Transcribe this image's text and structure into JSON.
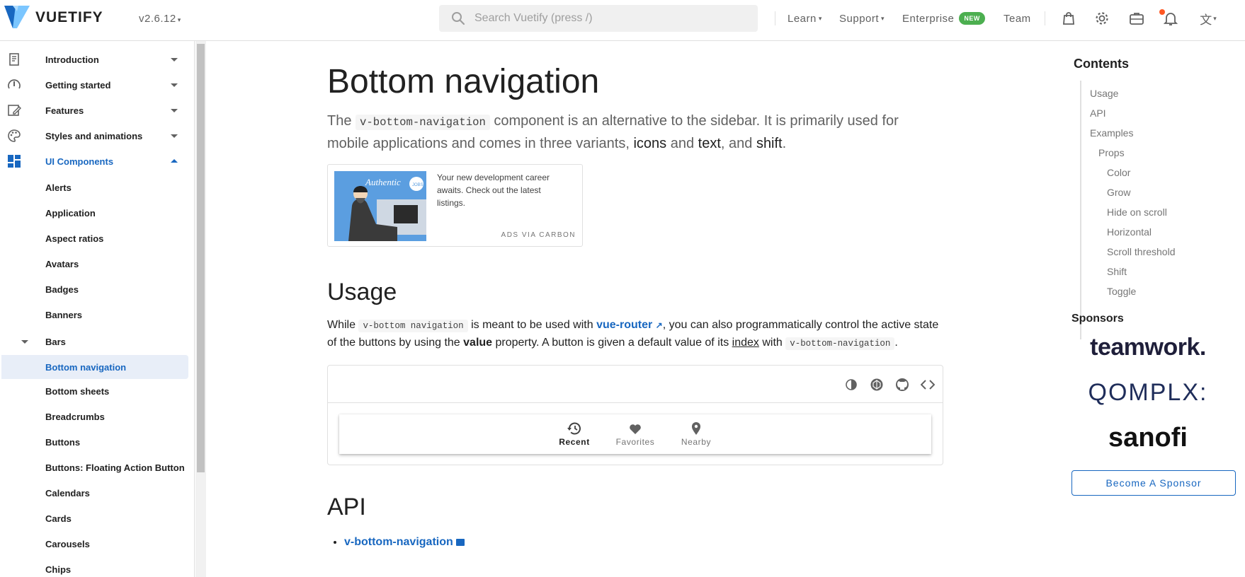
{
  "header": {
    "brand": "VUETIFY",
    "version": "v2.6.12",
    "search_placeholder": "Search Vuetify (press /)",
    "nav": {
      "learn": "Learn",
      "support": "Support",
      "enterprise": "Enterprise",
      "enterprise_badge": "NEW",
      "team": "Team"
    }
  },
  "sidebar": {
    "groups": [
      {
        "label": "Introduction"
      },
      {
        "label": "Getting started"
      },
      {
        "label": "Features"
      },
      {
        "label": "Styles and animations"
      },
      {
        "label": "UI Components"
      }
    ],
    "items": [
      {
        "label": "Alerts"
      },
      {
        "label": "Application"
      },
      {
        "label": "Aspect ratios"
      },
      {
        "label": "Avatars"
      },
      {
        "label": "Badges"
      },
      {
        "label": "Banners"
      },
      {
        "label": "Bars"
      },
      {
        "label": "Bottom navigation"
      },
      {
        "label": "Bottom sheets"
      },
      {
        "label": "Breadcrumbs"
      },
      {
        "label": "Buttons"
      },
      {
        "label": "Buttons: Floating Action Button"
      },
      {
        "label": "Calendars"
      },
      {
        "label": "Cards"
      },
      {
        "label": "Carousels"
      },
      {
        "label": "Chips"
      }
    ]
  },
  "main": {
    "title": "Bottom navigation",
    "lead": {
      "pre": "The ",
      "code": "v-bottom-navigation",
      "mid": " component is an alternative to the sidebar. It is primarily used for mobile applications and comes in three variants, ",
      "v1": "icons",
      "and1": " and ",
      "v2": "text",
      "and2": ", and ",
      "v3": "shift",
      "end": "."
    },
    "ad": {
      "image_text": "Authentic",
      "text": "Your new development career awaits. Check out the latest listings.",
      "carbon": "ADS VIA CARBON"
    },
    "usage": {
      "heading": "Usage",
      "p1": "While ",
      "code1": "v-bottom navigation",
      "p2": " is meant to be used with ",
      "link": "vue-router",
      "p3": ", you can also programmatically control the active state of the buttons by using the ",
      "bold": "value",
      "p4": " property. A button is given a default value of its ",
      "underline": "index",
      "p5": " with ",
      "code2": "v-bottom-navigation",
      "p6": "."
    },
    "example": {
      "buttons": [
        {
          "label": "Recent",
          "icon": "history-icon"
        },
        {
          "label": "Favorites",
          "icon": "heart-icon"
        },
        {
          "label": "Nearby",
          "icon": "map-marker-icon"
        }
      ]
    },
    "api": {
      "heading": "API",
      "link": "v-bottom-navigation"
    }
  },
  "toc": {
    "title": "Contents",
    "items": [
      "Usage",
      "API",
      "Examples",
      "Props",
      "Color",
      "Grow",
      "Hide on scroll",
      "Horizontal",
      "Scroll threshold",
      "Shift",
      "Toggle"
    ],
    "sponsors_title": "Sponsors",
    "sponsors": [
      "teamwork.",
      "QOMPLX:",
      "sanofi"
    ],
    "become": "Become A Sponsor"
  },
  "colors": {
    "primary": "#1867c0",
    "selected_bg": "#e8eef8",
    "badge_green": "#4caf50",
    "notification": "#ff5722"
  }
}
